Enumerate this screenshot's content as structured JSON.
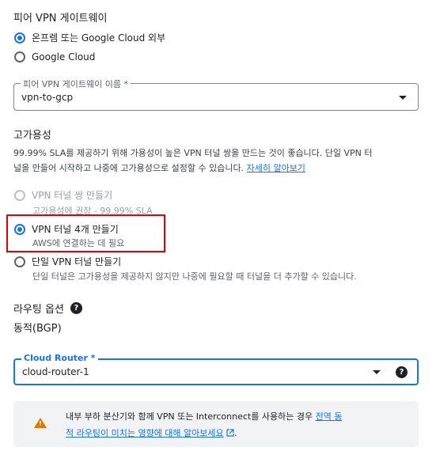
{
  "peer_gateway": {
    "title": "피어 VPN 게이트웨이",
    "options": [
      {
        "label": "온프렘 또는 Google Cloud 외부",
        "checked": true
      },
      {
        "label": "Google Cloud",
        "checked": false
      }
    ]
  },
  "peer_name_field": {
    "label": "피어 VPN 게이트웨이 이름 *",
    "value": "vpn-to-gcp"
  },
  "availability": {
    "title": "고가용성",
    "desc_part1": "99.99% SLA를 제공하기 위해 가용성이 높은 VPN 터널 쌍을 만드는 것이 좋습니다. 단일 VPN 터",
    "desc_part2": "널을 만들어 시작하고 나중에 고가용성으로 설정할 수 있습니다.",
    "learn_more": "자세히 알아보기",
    "options": [
      {
        "label": "VPN 터널 쌍 만들기",
        "sub": "고가용성에 권장 - 99.99% SLA",
        "state": "disabled"
      },
      {
        "label": "VPN 터널 4개 만들기",
        "sub": "AWS에 연결하는 데 필요",
        "state": "checked"
      },
      {
        "label": "단일 VPN 터널 만들기",
        "sub": "단일 터널은 고가용성을 제공하지 않지만 나중에 필요할 때 터널을 더 추가할 수 있습니다.",
        "state": "unchecked"
      }
    ],
    "highlight_color": "#e00000"
  },
  "routing": {
    "title": "라우팅 옵션",
    "help_glyph": "?",
    "value": "동적(BGP)"
  },
  "cloud_router": {
    "label": "Cloud Router *",
    "value": "cloud-router-1",
    "help_glyph": "?",
    "accent": "#1a73e8"
  },
  "banner": {
    "icon": "warning-icon",
    "text": "내부 부하 분산기와 함께 VPN 또는 Interconnect를 사용하는 경우",
    "link_part1": "전역 동",
    "link_part2": "적 라우팅이 미치는 영향에 대해 알아보세요",
    "external_icon": "external-link-icon",
    "end": "."
  }
}
